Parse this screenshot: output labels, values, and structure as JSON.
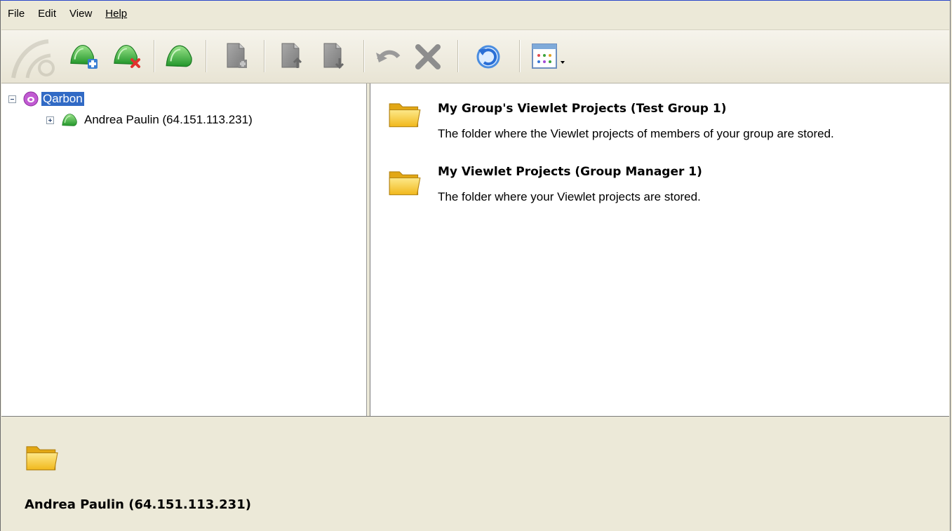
{
  "menu": {
    "file": "File",
    "edit": "Edit",
    "view": "View",
    "help": "Help"
  },
  "toolbar": {
    "icons": [
      "logo-watermark-icon",
      "add-user-icon",
      "remove-user-icon",
      "user-icon",
      "new-project-icon",
      "import-project-icon",
      "export-project-icon",
      "undo-icon",
      "delete-icon",
      "refresh-icon",
      "view-options-icon"
    ]
  },
  "tree": {
    "root_label": "Qarbon",
    "child_label": "Andrea Paulin (64.151.113.231)"
  },
  "content": {
    "entries": [
      {
        "title": "My Group's Viewlet Projects (Test Group 1)",
        "description": "The folder where the Viewlet projects of members of your group are stored."
      },
      {
        "title": "My Viewlet Projects (Group Manager 1)",
        "description": "The folder where your Viewlet projects are stored."
      }
    ]
  },
  "details": {
    "title": "Andrea Paulin (64.151.113.231)"
  },
  "colors": {
    "selection": "#316ac5",
    "folder": "#f7c734",
    "user_green": "#3cb43a",
    "root_purple": "#b84fc7"
  }
}
